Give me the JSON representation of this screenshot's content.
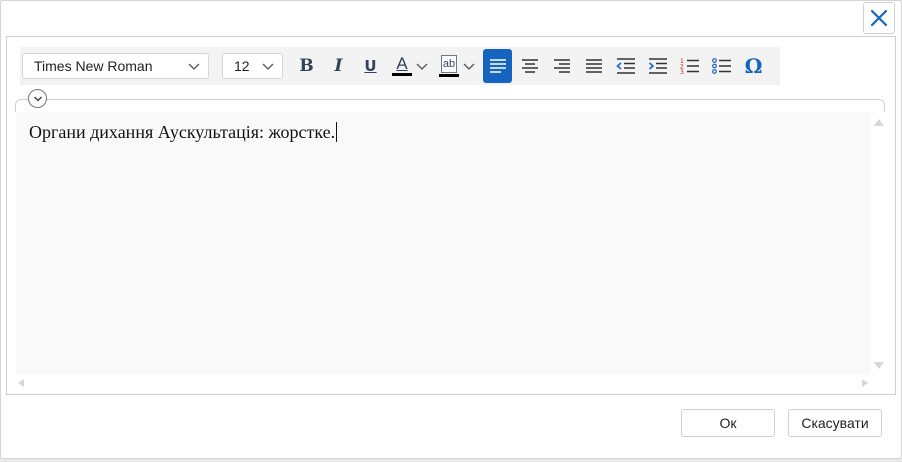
{
  "window": {
    "close_icon": "close-icon",
    "accent_color": "#1565c0"
  },
  "toolbar": {
    "font_family_value": "Times New Roman",
    "font_size_value": "12",
    "bold_label": "B",
    "italic_label": "I",
    "underline_label": "U",
    "font_color_label": "A",
    "highlight_label": "ab",
    "special_char_label": "Ω",
    "font_color": "#000000",
    "highlight_color": "#000000",
    "active_alignment": "align-left"
  },
  "editor": {
    "text": "Органи дихання Аускультація: жорстке."
  },
  "footer": {
    "ok_label": "Ок",
    "cancel_label": "Скасувати"
  }
}
